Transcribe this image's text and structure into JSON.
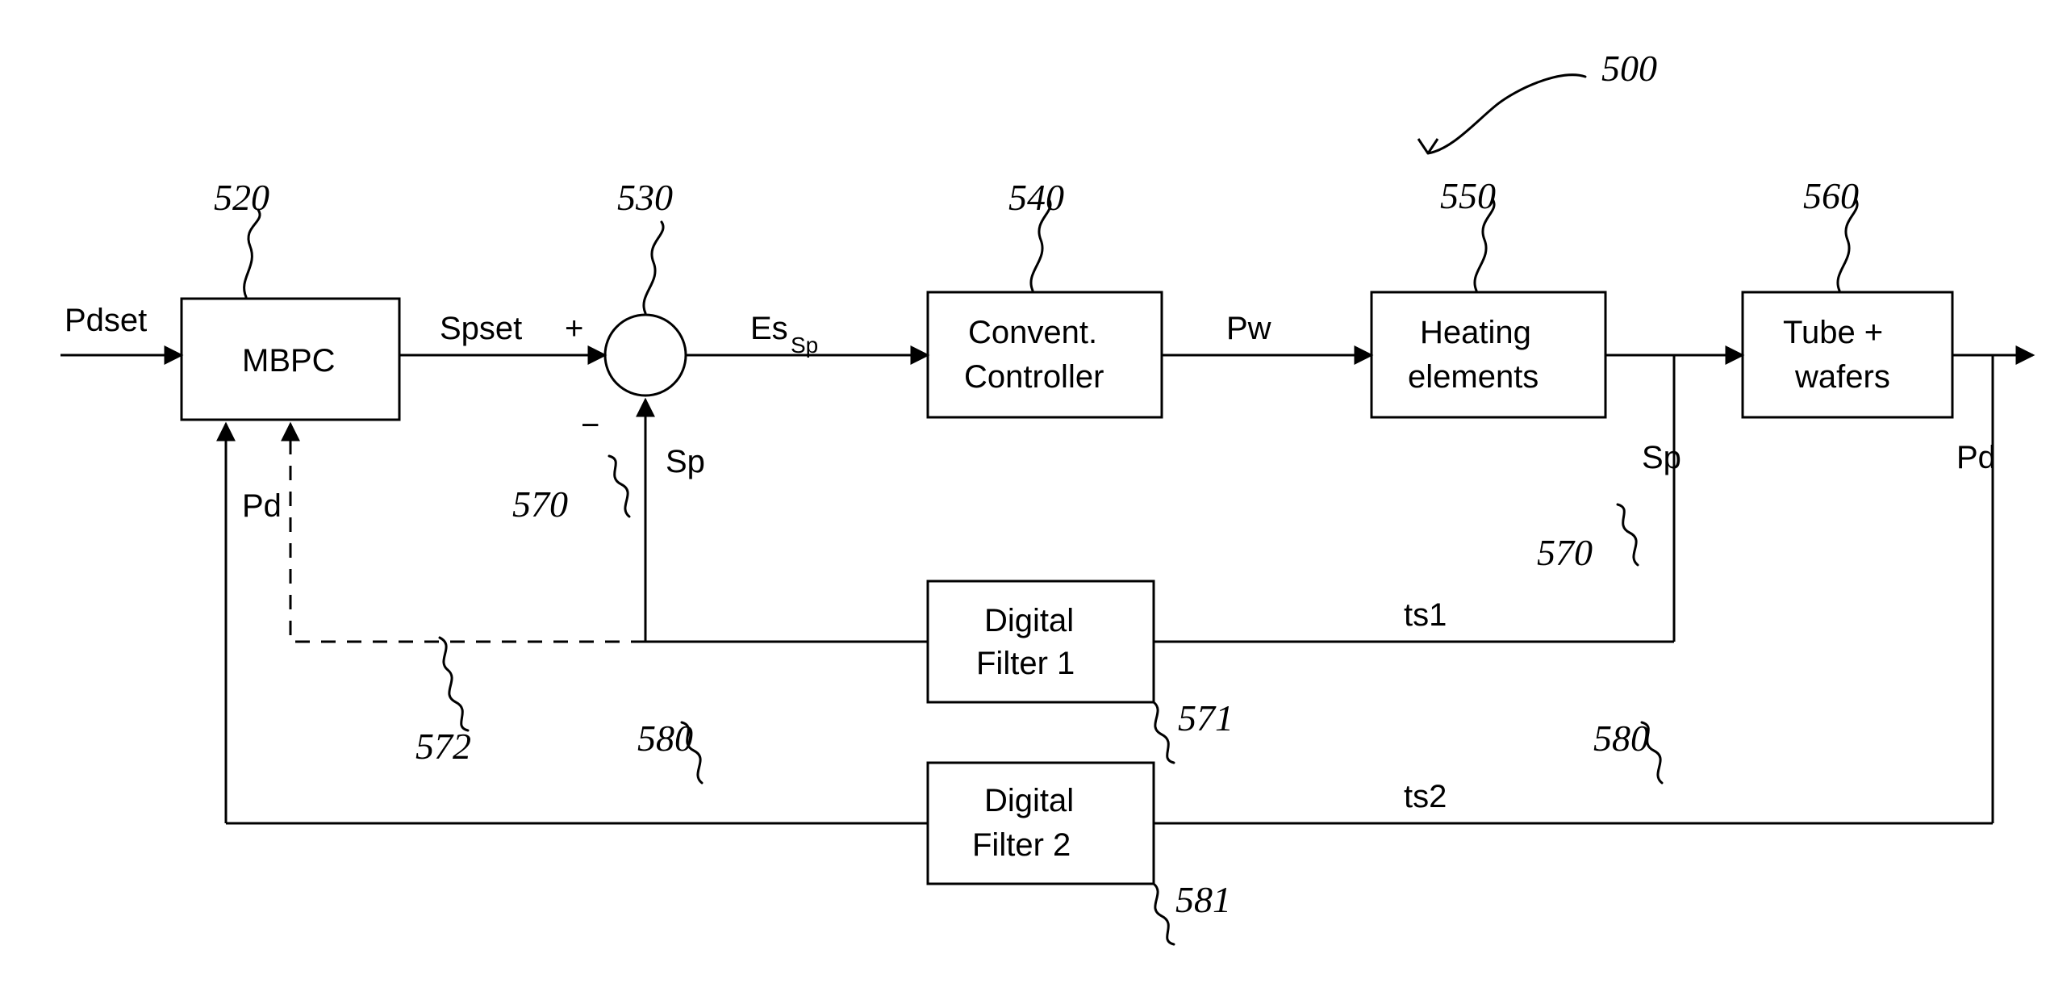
{
  "diagram_ref": "500",
  "input_label": "Pdset",
  "blocks": {
    "mbpc": {
      "ref": "520",
      "text": "MBPC"
    },
    "sum": {
      "ref": "530",
      "pos_sign": "+",
      "neg_sign": "−"
    },
    "conv_controller": {
      "ref": "540",
      "line1": "Convent.",
      "line2": "Controller"
    },
    "heating": {
      "ref": "550",
      "line1": "Heating",
      "line2": "elements"
    },
    "tube_wafers": {
      "ref": "560",
      "line1": "Tube +",
      "line2": "wafers"
    },
    "digital_filter1": {
      "ref": "571",
      "line1": "Digital",
      "line2": "Filter 1"
    },
    "digital_filter2": {
      "ref": "581",
      "line1": "Digital",
      "line2": "Filter  2"
    }
  },
  "signals": {
    "spset": "Spset",
    "essp_main": "Es",
    "essp_sub": "Sp",
    "pw": "Pw",
    "pd_out": "Pd",
    "pd_fb": "Pd",
    "sp_fb_top": "Sp",
    "sp_fb_right": "Sp",
    "ts1": "ts1",
    "ts2": "ts2"
  },
  "refs": {
    "sp_left": "570",
    "sp_right": "570",
    "dashed_ref": "572",
    "pd_path_left": "580",
    "pd_path_right": "580"
  }
}
